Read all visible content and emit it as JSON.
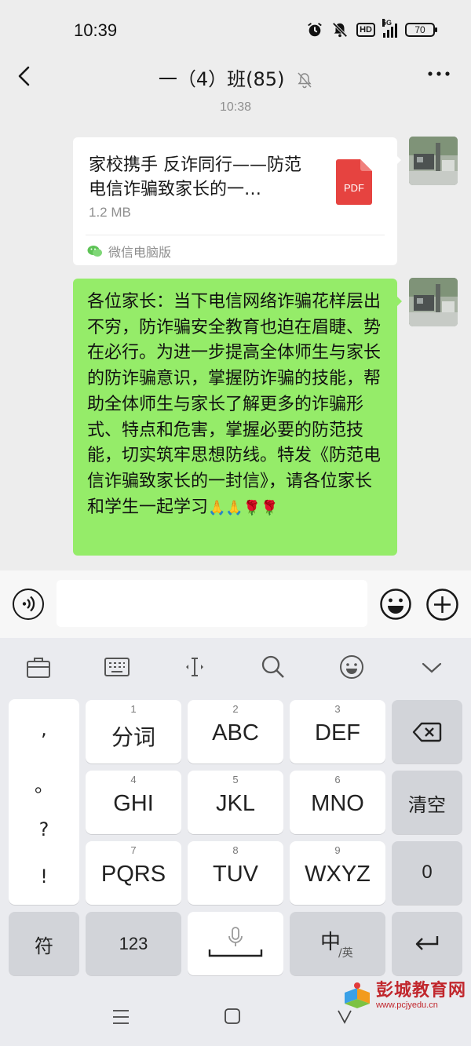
{
  "status_bar": {
    "time": "10:39",
    "battery": "70",
    "network": "5G",
    "hd": "HD"
  },
  "nav": {
    "title": "一（4）班(85)"
  },
  "chat": {
    "timestamp": "10:38",
    "file_message": {
      "name": "家校携手 反诈同行——防范电信诈骗致家长的一…",
      "size": "1.2 MB",
      "type_label": "PDF",
      "source": "微信电脑版"
    },
    "text_message": "各位家长：当下电信网络诈骗花样层出不穷，防诈骗安全教育也迫在眉睫、势在必行。为进一步提高全体师生与家长的防诈骗意识，掌握防诈骗的技能，帮助全体师生与家长了解更多的诈骗形式、特点和危害，掌握必要的防范技能，切实筑牢思想防线。特发《防范电信诈骗致家长的一封信》，请各位家长和学生一起学习",
    "text_emojis": "🙏🙏🌹🌹"
  },
  "keyboard": {
    "punctuation": [
      ",",
      "。",
      "?",
      "!"
    ],
    "keys": [
      {
        "num": "1",
        "label": "分词"
      },
      {
        "num": "2",
        "label": "ABC"
      },
      {
        "num": "3",
        "label": "DEF"
      },
      {
        "num": "4",
        "label": "GHI"
      },
      {
        "num": "5",
        "label": "JKL"
      },
      {
        "num": "6",
        "label": "MNO"
      },
      {
        "num": "7",
        "label": "PQRS"
      },
      {
        "num": "8",
        "label": "TUV"
      },
      {
        "num": "9",
        "label": "WXYZ"
      }
    ],
    "clear": "清空",
    "zero": "0",
    "symbols": "符",
    "numbers": "123",
    "lang_main": "中",
    "lang_sub": "/英"
  },
  "watermark": {
    "title": "彭城教育网",
    "url": "www.pcjyedu.cn"
  },
  "colors": {
    "bubble_green": "#95ec69",
    "background": "#ededed",
    "pdf_red": "#e64340"
  }
}
